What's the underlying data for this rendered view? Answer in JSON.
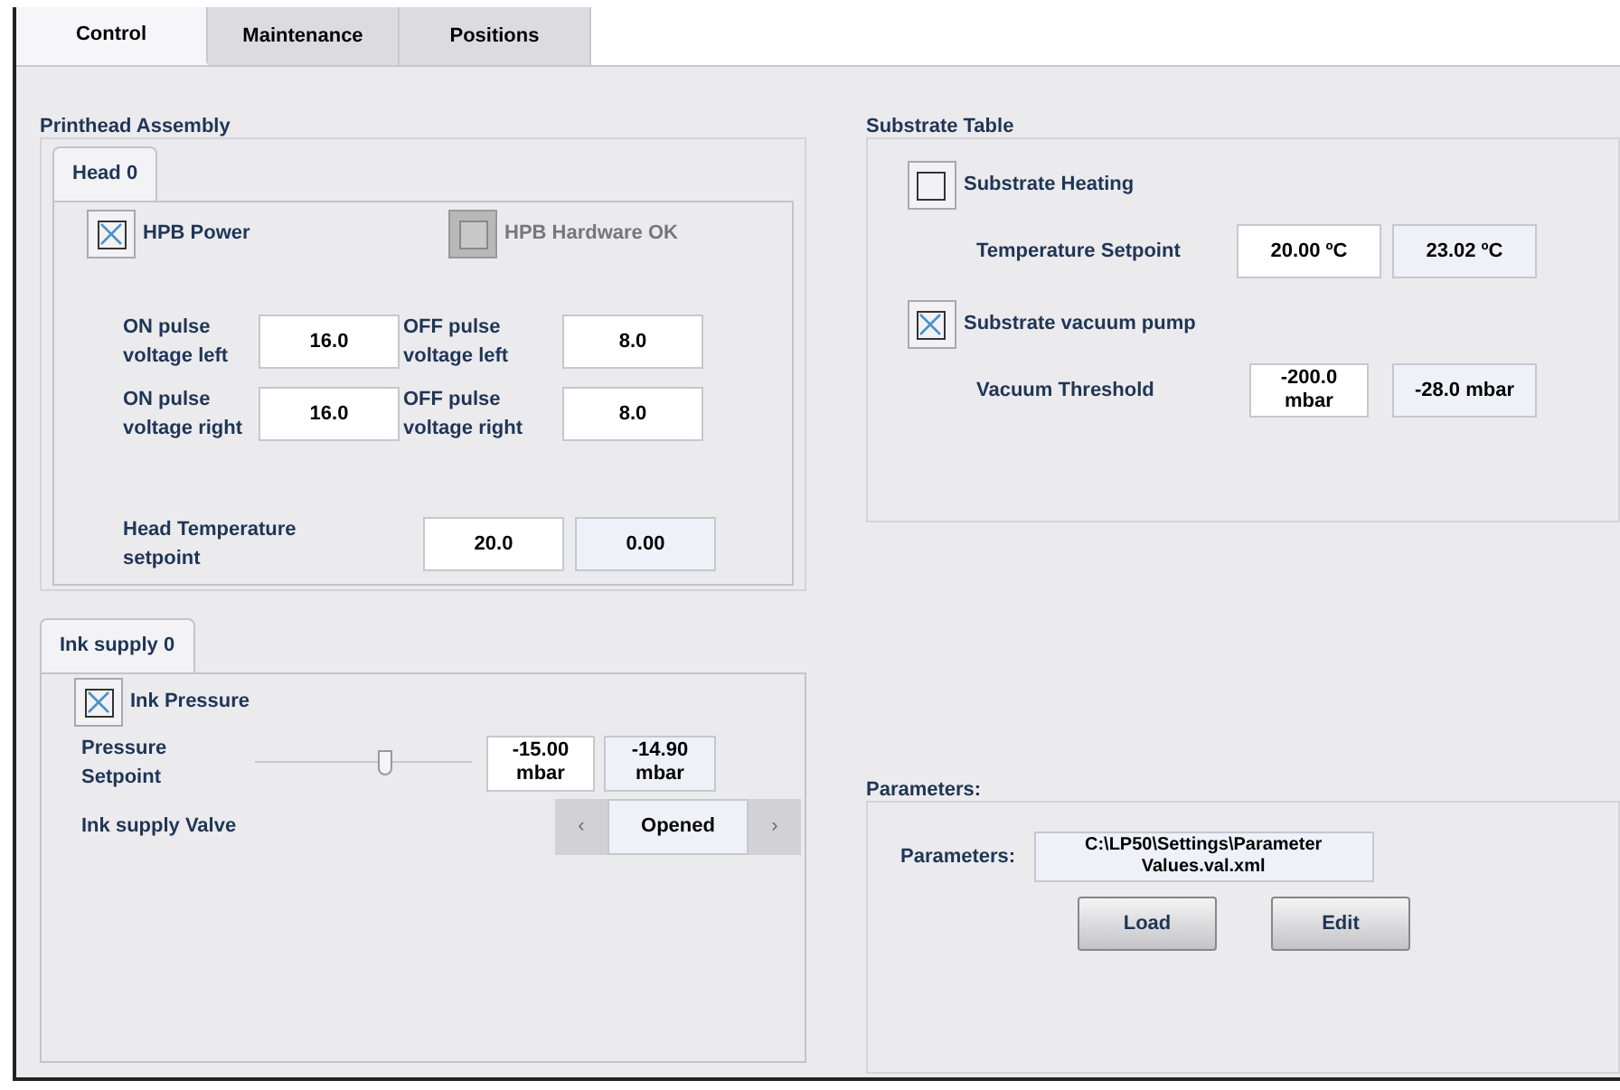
{
  "tabs": [
    {
      "label": "Control",
      "selected": true
    },
    {
      "label": "Maintenance",
      "selected": false
    },
    {
      "label": "Positions",
      "selected": false
    }
  ],
  "printhead": {
    "title": "Printhead Assembly",
    "head_tab": {
      "label": "Head 0",
      "selected": true
    },
    "checkboxes": [
      {
        "label": "HPB Power",
        "checked": true,
        "disabled": false
      },
      {
        "label": "HPB Hardware OK",
        "checked": false,
        "disabled": true
      }
    ],
    "pulse_fields": [
      {
        "label": "ON pulse voltage left",
        "value": "16.0"
      },
      {
        "label": "OFF pulse voltage left",
        "value": "8.0"
      },
      {
        "label": "ON pulse voltage right",
        "value": "16.0"
      },
      {
        "label": "OFF pulse voltage right",
        "value": "8.0"
      }
    ],
    "temperature": {
      "label": "Head Temperature setpoint",
      "value": "20.0",
      "reading": "0.00"
    }
  },
  "ink_supply": {
    "tab": {
      "label": "Ink supply 0",
      "selected": true
    },
    "checkbox": {
      "label": "Ink Pressure",
      "checked": true
    },
    "pressure": {
      "label": "Pressure Setpoint",
      "level": 0.6,
      "value": "-15.00 mbar",
      "reading": "-14.90 mbar"
    },
    "valve": {
      "label": "Ink supply Valve",
      "value": "Opened",
      "prev": "‹",
      "next": "›"
    }
  },
  "substrate": {
    "title": "Substrate Table",
    "rows": [
      {
        "checkbox": {
          "label": "Substrate Heating",
          "checked": false
        },
        "label": "Temperature Setpoint",
        "value": "20.00 ºC",
        "reading": "23.02 ºC"
      },
      {
        "checkbox": {
          "label": "Substrate vacuum pump",
          "checked": true
        },
        "label": "Vacuum Threshold",
        "value": "-200.0 mbar",
        "reading": "-28.0 mbar"
      }
    ]
  },
  "parameters": {
    "title": "Parameters:",
    "label": "Parameters:",
    "path": "C:\\LP50\\Settings\\Parameter Values.val.xml",
    "buttons": [
      "Load",
      "Edit"
    ]
  }
}
